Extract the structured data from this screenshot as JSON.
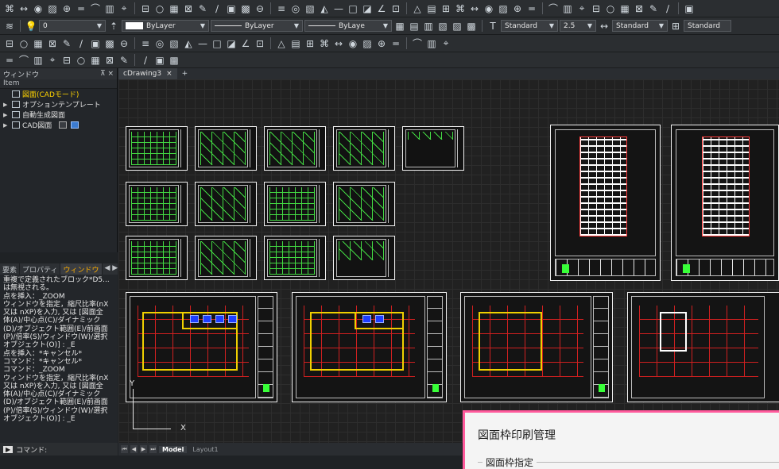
{
  "toolbar": {
    "row1_icons": [
      "text-style-icon",
      "dim-style-icon",
      "table-style-icon",
      "multileader-style-icon",
      "dim-linear-icon",
      "dim-aligned-icon",
      "dim-angle-icon",
      "dim-radius-icon",
      "line-icon",
      "polyline-icon",
      "arc-icon",
      "circle-icon",
      "rectangle-icon",
      "hatch-icon",
      "insert-block-icon",
      "table-icon",
      "text-icon",
      "properties-icon",
      "layer-icon",
      "zoom-icon",
      "measure-icon",
      "plot-icon"
    ],
    "layer_value": "0",
    "color_value": "ByLayer",
    "linetype_value": "ByLayer",
    "lineweight_value": "ByLaye",
    "text_style_value": "Standard",
    "text_height_value": "2.5",
    "dim_style_value": "Standard",
    "table_style_value": "Standard"
  },
  "window_panel": {
    "title": "ウィンドウ",
    "pin": "⊼ ×",
    "header": "Item",
    "items": [
      {
        "label": "図面(CADモード)",
        "selected": true,
        "caret": ""
      },
      {
        "label": "オプションテンプレート",
        "selected": false,
        "caret": "▶"
      },
      {
        "label": "自動生成図面",
        "selected": false,
        "caret": "▶"
      },
      {
        "label": "CAD図面",
        "selected": false,
        "caret": "▶"
      }
    ]
  },
  "side_tabs": [
    "要素",
    "プロパティ",
    "ウィンドウ"
  ],
  "side_tabs_arrows": "◀ ▶",
  "command_history": [
    "重複で定義されたブロック*D5...",
    "は無視される。",
    "点を挿入：_ZOOM",
    "ウィンドウを指定，縮尺比率(nX",
    "又は nXP)を入力, 又は [図面全",
    "体(A)/中心点(C)/ダイナミック",
    "(D)/オブジェクト範囲(E)/前画面",
    "(P)/倍率(S)/ウィンドウ(W)/選択",
    "オブジェクト(O)] : _E",
    "点を挿入：*キャンセル*",
    "コマンド：*キャンセル*",
    "コマンド：_ZOOM",
    "ウィンドウを指定，縮尺比率(nX",
    "又は nXP)を入力, 又は [図面全",
    "体(A)/中心点(C)/ダイナミック",
    "(D)/オブジェクト範囲(E)/前画面",
    "(P)/倍率(S)/ウィンドウ(W)/選択",
    "オブジェクト(O)] : _E"
  ],
  "command_prompt": "コマンド:",
  "document_tab": {
    "label": "cDrawing3",
    "close": "×",
    "plus": "+"
  },
  "layout_tabs": {
    "model": "Model",
    "layout": "Layout1"
  },
  "ucs": {
    "x_label": "X",
    "y_label": "Y"
  },
  "dialog": {
    "title": "図面枠印刷管理",
    "group_label": "図面枠指定"
  }
}
